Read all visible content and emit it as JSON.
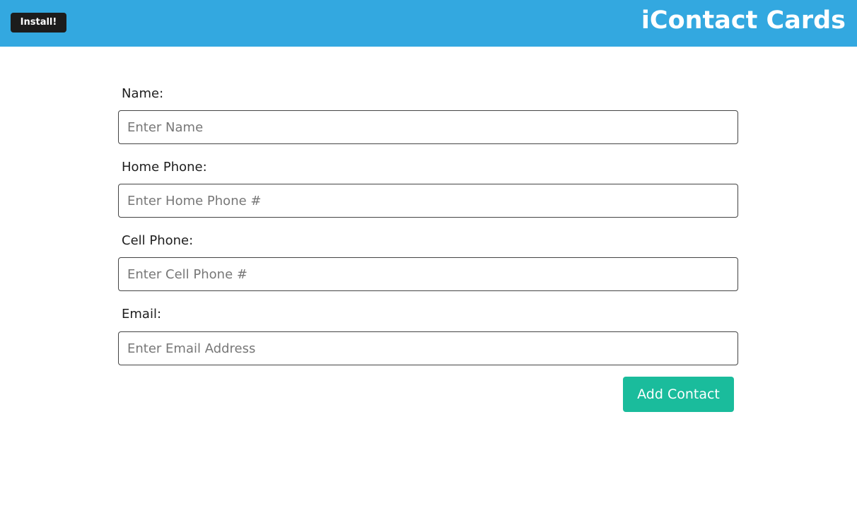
{
  "header": {
    "install_label": "Install!",
    "title": "iContact Cards",
    "background_color": "#33a8e0"
  },
  "form": {
    "name": {
      "label": "Name:",
      "placeholder": "Enter Name",
      "value": ""
    },
    "home_phone": {
      "label": "Home Phone:",
      "placeholder": "Enter Home Phone #",
      "value": ""
    },
    "cell_phone": {
      "label": "Cell Phone:",
      "placeholder": "Enter Cell Phone #",
      "value": ""
    },
    "email": {
      "label": "Email:",
      "placeholder": "Enter Email Address",
      "value": ""
    },
    "submit_label": "Add Contact",
    "submit_color": "#1abc9c"
  }
}
